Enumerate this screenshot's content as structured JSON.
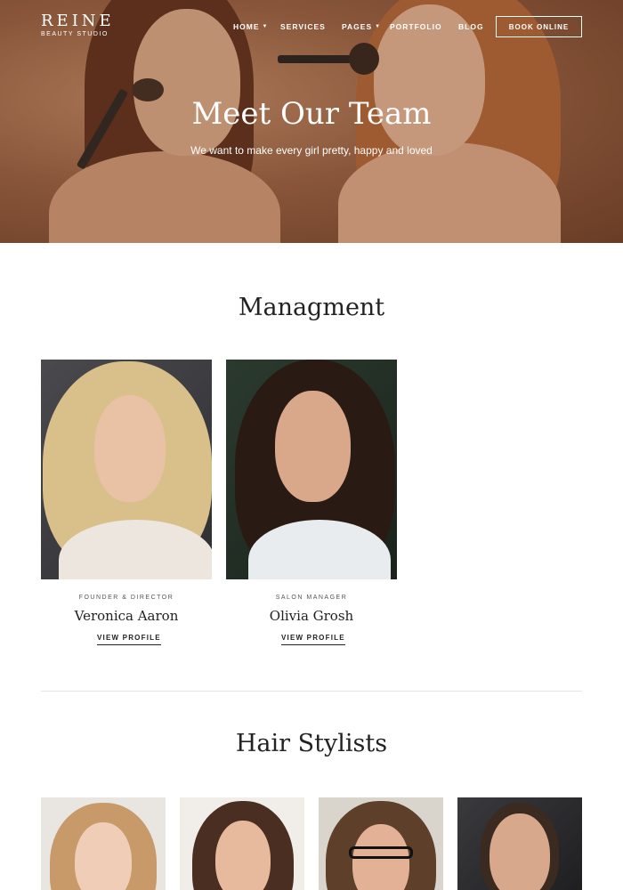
{
  "brand": {
    "name": "REINE",
    "tagline": "BEAUTY STUDIO"
  },
  "nav": {
    "items": [
      {
        "label": "HOME",
        "has_dropdown": true
      },
      {
        "label": "SERVICES",
        "has_dropdown": false
      },
      {
        "label": "PAGES",
        "has_dropdown": true
      },
      {
        "label": "PORTFOLIO",
        "has_dropdown": false
      },
      {
        "label": "BLOG",
        "has_dropdown": false
      }
    ],
    "cta": "BOOK ONLINE"
  },
  "hero": {
    "title": "Meet Our Team",
    "subtitle": "We want to make every girl pretty, happy and loved"
  },
  "management": {
    "title": "Managment",
    "members": [
      {
        "role": "FOUNDER & DIRECTOR",
        "name": "Veronica Aaron",
        "link": "VIEW PROFILE"
      },
      {
        "role": "SALON MANAGER",
        "name": "Olivia Grosh",
        "link": "VIEW PROFILE"
      }
    ]
  },
  "hair_stylists": {
    "title": "Hair Stylists"
  },
  "colors": {
    "hero_tint": "#9a6446",
    "text": "#222222",
    "divider": "#e6e6e6"
  }
}
